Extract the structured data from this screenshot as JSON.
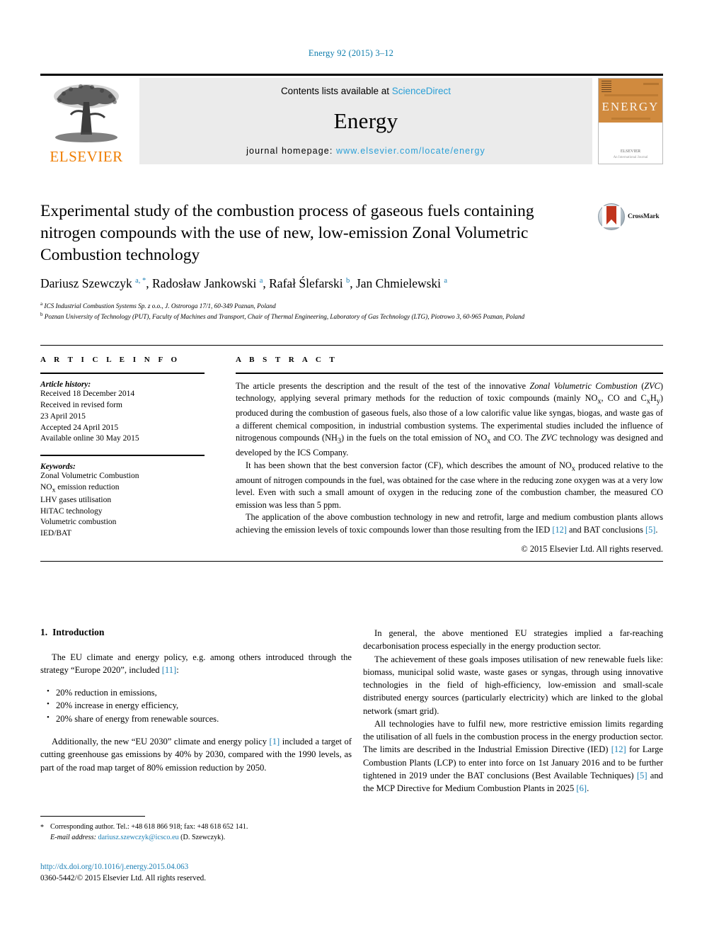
{
  "running_head": "Energy 92 (2015) 3–12",
  "masthead": {
    "contents_prefix": "Contents lists available at ",
    "sciencedirect": "ScienceDirect",
    "journal_name": "Energy",
    "homepage_prefix": "journal homepage: ",
    "homepage_url": "www.elsevier.com/locate/energy",
    "publisher_logo_text": "ELSEVIER",
    "cover_title": "ENERGY",
    "cover_publisher": "ELSEVIER",
    "cover_sub": "An International Journal"
  },
  "crossmark": {
    "label": "CrossMark"
  },
  "article": {
    "title": "Experimental study of the combustion process of gaseous fuels containing nitrogen compounds with the use of new, low-emission Zonal Volumetric Combustion technology",
    "authors_html": "Dariusz Szewczyk <sup>a, *</sup>, Radosław Jankowski <sup>a</sup>, Rafał Ślefarski <sup>b</sup>, Jan Chmielewski <sup>a</sup>",
    "affiliations": [
      "ICS Industrial Combustion Systems Sp. z o.o., J. Ostroroga 17/1, 60-349 Poznan, Poland",
      "Poznan University of Technology (PUT), Faculty of Machines and Transport, Chair of Thermal Engineering, Laboratory of Gas Technology (LTG), Piotrowo 3, 60-965 Poznan, Poland"
    ]
  },
  "article_info": {
    "heading": "A R T I C L E  I N F O",
    "history_label": "Article history:",
    "history": [
      "Received 18 December 2014",
      "Received in revised form",
      "23 April 2015",
      "Accepted 24 April 2015",
      "Available online 30 May 2015"
    ],
    "keywords_label": "Keywords:",
    "keywords": [
      "Zonal Volumetric Combustion",
      "NOx emission reduction",
      "LHV gases utilisation",
      "HiTAC technology",
      "Volumetric combustion",
      "IED/BAT"
    ]
  },
  "abstract": {
    "heading": "A B S T R A C T",
    "paragraphs": [
      "The article presents the description and the result of the test of the innovative Zonal Volumetric Combustion (ZVC) technology, applying several primary methods for the reduction of toxic compounds (mainly NOx, CO and CxHy) produced during the combustion of gaseous fuels, also those of a low calorific value like syngas, biogas, and waste gas of a different chemical composition, in industrial combustion systems. The experimental studies included the influence of nitrogenous compounds (NH3) in the fuels on the total emission of NOx and CO. The ZVC technology was designed and developed by the ICS Company.",
      "It has been shown that the best conversion factor (CF), which describes the amount of NOx produced relative to the amount of nitrogen compounds in the fuel, was obtained for the case where in the reducing zone oxygen was at a very low level. Even with such a small amount of oxygen in the reducing zone of the combustion chamber, the measured CO emission was less than 5 ppm.",
      "The application of the above combustion technology in new and retrofit, large and medium combustion plants allows achieving the emission levels of toxic compounds lower than those resulting from the IED [12] and BAT conclusions [5]."
    ],
    "copyright": "© 2015 Elsevier Ltd. All rights reserved."
  },
  "introduction": {
    "number": "1.",
    "heading": "Introduction",
    "left_p1": "The EU climate and energy policy, e.g. among others introduced through the strategy “Europe 2020”, included [11]:",
    "left_p1_ref": "[11]",
    "bullets": [
      "20% reduction in emissions,",
      "20% increase in energy efficiency,",
      "20% share of energy from renewable sources."
    ],
    "left_p2": "Additionally, the new “EU 2030” climate and energy policy [1] included a target of cutting greenhouse gas emissions by 40% by 2030, compared with the 1990 levels, as part of the road map target of 80% emission reduction by 2050.",
    "right_p1": "In general, the above mentioned EU strategies implied a far-reaching decarbonisation process especially in the energy production sector.",
    "right_p2": "The achievement of these goals imposes utilisation of new renewable fuels like: biomass, municipal solid waste, waste gases or syngas, through using innovative technologies in the field of high-efficiency, low-emission and small-scale distributed energy sources (particularly electricity) which are linked to the global network (smart grid).",
    "right_p3": "All technologies have to fulfil new, more restrictive emission limits regarding the utilisation of all fuels in the combustion process in the energy production sector. The limits are described in the Industrial Emission Directive (IED) [12] for Large Combustion Plants (LCP) to enter into force on 1st January 2016 and to be further tightened in 2019 under the BAT conclusions (Best Available Techniques) [5] and the MCP Directive for Medium Combustion Plants in 2025 [6]."
  },
  "footnote": {
    "marker": "*",
    "line1": "Corresponding author. Tel.: +48 618 866 918; fax: +48 618 652 141.",
    "email_label": "E-mail address:",
    "email": "dariusz.szewczyk@icsco.eu",
    "email_suffix": "(D. Szewczyk)."
  },
  "footer": {
    "doi": "http://dx.doi.org/10.1016/j.energy.2015.04.063",
    "issn": "0360-5442/© 2015 Elsevier Ltd. All rights reserved."
  },
  "colors": {
    "link": "#1b7fb5",
    "sciencedirect": "#2a9fd6",
    "elsevier_orange": "#ef7d00",
    "crossmark_red": "#c0341d"
  }
}
